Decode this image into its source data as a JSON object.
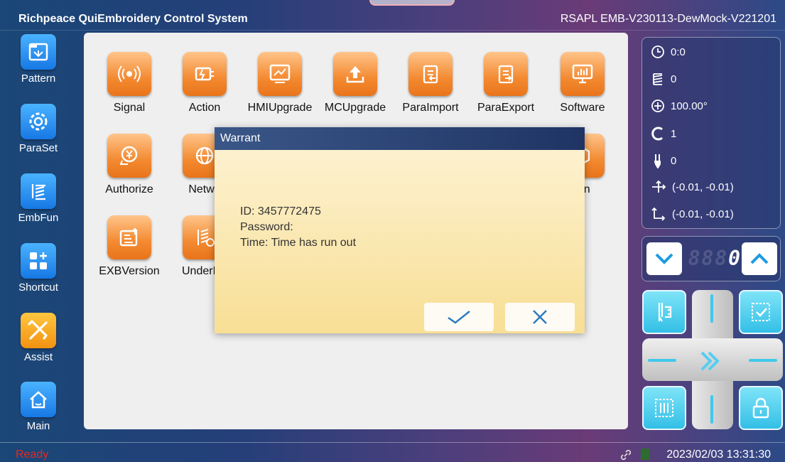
{
  "header": {
    "app_title": "Richpeace QuiEmbroidery Control System",
    "version": "RSAPL EMB-V230113-DewMock-V221201"
  },
  "sidebar": {
    "items": [
      {
        "label": "Pattern",
        "icon": "pattern-icon"
      },
      {
        "label": "ParaSet",
        "icon": "gear-icon"
      },
      {
        "label": "EmbFun",
        "icon": "embroidery-icon"
      },
      {
        "label": "Shortcut",
        "icon": "shortcut-icon"
      },
      {
        "label": "Assist",
        "icon": "tools-icon"
      },
      {
        "label": "Main",
        "icon": "home-icon"
      }
    ]
  },
  "tiles": [
    {
      "label": "Signal",
      "icon": "signal-icon"
    },
    {
      "label": "Action",
      "icon": "action-icon"
    },
    {
      "label": "HMIUpgrade",
      "icon": "hmi-upgrade-icon"
    },
    {
      "label": "MCUpgrade",
      "icon": "mc-upgrade-icon"
    },
    {
      "label": "ParaImport",
      "icon": "para-import-icon"
    },
    {
      "label": "ParaExport",
      "icon": "para-export-icon"
    },
    {
      "label": "Software",
      "icon": "software-icon"
    },
    {
      "label": "Authorize",
      "icon": "authorize-icon"
    },
    {
      "label": "Netwo",
      "icon": "network-icon"
    },
    {
      "label": "ion",
      "icon": "version-icon"
    },
    {
      "label": "EXBVersion",
      "icon": "exb-version-icon"
    },
    {
      "label": "UnderDe",
      "icon": "under-device-icon"
    }
  ],
  "status": {
    "time": "0:0",
    "stitches": "0",
    "angle": "100.00°",
    "c_count": "1",
    "needle": "0",
    "position": "(-0.01, -0.01)",
    "origin": "(-0.01, -0.01)"
  },
  "counter": {
    "value": "0",
    "ghost_digits": "888"
  },
  "dialog": {
    "title": "Warrant",
    "id_line": "ID:  3457772475",
    "password_line": "Password:",
    "time_line": "Time: Time has run out"
  },
  "statusbar": {
    "state": "Ready",
    "datetime": "2023/02/03 13:31:30"
  },
  "colors": {
    "ready": "#e8281e",
    "accent": "#3ec9ec",
    "tile": "#f38a31",
    "side_blue": "#1778e4"
  }
}
